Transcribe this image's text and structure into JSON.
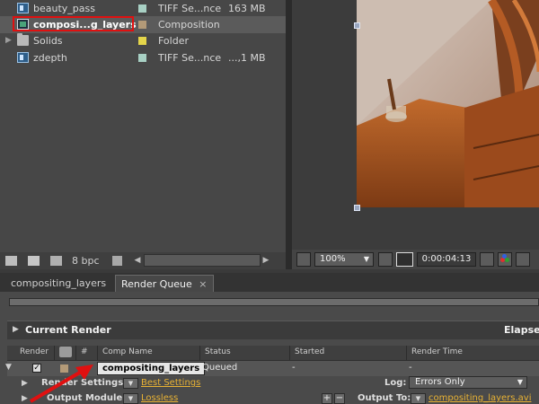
{
  "project": {
    "items": [
      {
        "name": "beauty_pass",
        "type": "TIFF Se...nce",
        "size": "163 MB",
        "label_color": "#a8d0c4",
        "icon": "footage-icon"
      },
      {
        "name": "composi...g_layers",
        "type": "Composition",
        "size": "",
        "label_color": "#b39a78",
        "icon": "composition-icon"
      },
      {
        "name": "Solids",
        "type": "Folder",
        "size": "",
        "label_color": "#e4d54a",
        "icon": "folder-icon"
      },
      {
        "name": "zdepth",
        "type": "TIFF Se...nce",
        "size": "...,1 MB",
        "label_color": "#a8d0c4",
        "icon": "footage-icon"
      }
    ],
    "bit_depth": "8 bpc"
  },
  "viewer": {
    "zoom": "100%",
    "timecode": "0:00:04:13"
  },
  "tabs": [
    {
      "label": "compositing_layers"
    },
    {
      "label": "Render Queue"
    }
  ],
  "render_queue": {
    "current_render_label": "Current Render",
    "elapsed_label": "Elapsed:",
    "columns": [
      "Render",
      "#",
      "Comp Name",
      "Status",
      "Started",
      "Render Time"
    ],
    "item": {
      "comp_name": "compositing_layers",
      "status": "Queued",
      "started": "-",
      "render_time": "-",
      "label_color": "#b39a78"
    },
    "render_settings_label": "Render Settings:",
    "render_settings_value": "Best Settings",
    "log_label": "Log:",
    "log_value": "Errors Only",
    "output_module_label": "Output Module:",
    "output_module_value": "Lossless",
    "output_to_label": "Output To:",
    "output_to_value": "compositing_layers.avi"
  },
  "colors": {
    "accent_link": "#e8b234",
    "highlight_red": "#e01010"
  }
}
